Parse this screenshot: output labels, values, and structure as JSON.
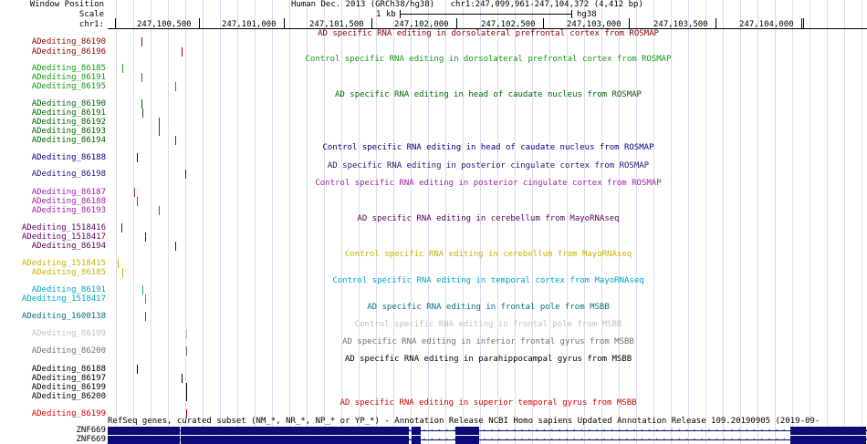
{
  "ruler": {
    "window_position_label": "Window Position",
    "scale_label": "Scale",
    "chrom_label": "chr1:",
    "assembly": "Human Dec. 2013 (GRCh38/hg38)",
    "range": "chr1:247,099,961-247,104,372 (4,412 bp)",
    "scale_value": "1 kb",
    "scale_db": "hg38",
    "positions": [
      "247,100,500",
      "247,101,000",
      "247,101,500",
      "247,102,000",
      "247,102,500",
      "247,103,000",
      "247,103,500",
      "247,104,000"
    ]
  },
  "tracks": [
    {
      "title": "AD specific RNA editing in dorsolateral prefrontal cortex from ROSMAP",
      "color": "#8b0000",
      "items": [
        "ADediting_86190",
        "ADediting_86196"
      ]
    },
    {
      "title": "Control specific RNA editing in dorsolateral prefrontal cortex from ROSMAP",
      "color": "#139a13",
      "items": [
        "ADediting_86185",
        "ADediting_86191",
        "ADediting_86195"
      ]
    },
    {
      "title": "AD specific RNA editing in head of caudate nucleus from ROSMAP",
      "color": "#006400",
      "items": [
        "ADediting_86190",
        "ADediting_86191",
        "ADediting_86192",
        "ADediting_86193",
        "ADediting_86194"
      ]
    },
    {
      "title": "Control specific RNA editing in head of caudate nucleus from ROSMAP",
      "color": "#000080",
      "items": [
        "ADediting_86188"
      ]
    },
    {
      "title": "AD specific RNA editing in posterior cingulate cortex from ROSMAP",
      "color": "#191970",
      "items": [
        "ADediting_86198"
      ]
    },
    {
      "title": "Control specific RNA editing in posterior cingulate cortex from ROSMAP",
      "color": "#a020a0",
      "items": [
        "ADediting_86187",
        "ADediting_86188",
        "ADediting_86193"
      ]
    },
    {
      "title": "AD specific RNA editing in cerebellum from MayoRNAseq",
      "color": "#5c005c",
      "items": [
        "ADediting_1518416",
        "ADediting_1518417",
        "ADediting_86194"
      ]
    },
    {
      "title": "Control specific RNA editing in cerebellum from MayoRNAseq",
      "color": "#c8b400",
      "items": [
        "ADediting_1518415",
        "ADediting_86185"
      ]
    },
    {
      "title": "Control specific RNA editing in temporal cortex from MayoRNAseq",
      "color": "#00a8c0",
      "items": [
        "ADediting_86191",
        "ADediting_1518417"
      ]
    },
    {
      "title": "AD specific RNA editing in frontal pole from MSBB",
      "color": "#007080",
      "items": [
        "ADediting_1600138"
      ]
    },
    {
      "title": "Control specific RNA editing in frontal pole from MSBB",
      "color": "#c0c0c0",
      "items": [
        "ADediting_86199"
      ]
    },
    {
      "title": "AD specific RNA editing in inferior frontal gyrus from MSBB",
      "color": "#707070",
      "items": [
        "ADediting_86200"
      ]
    },
    {
      "title": "AD specific RNA editing in parahippocampal gyrus from MSBB",
      "color": "#000000",
      "items": [
        "ADediting_86188",
        "ADediting_86197",
        "ADediting_86199",
        "ADediting_86200"
      ]
    },
    {
      "title": "AD specific RNA editing in superior temporal gyrus from MSBB",
      "color": "#d00000",
      "items": [
        "ADediting_86199"
      ]
    }
  ],
  "refseq": {
    "title": "RefSeq genes, curated subset (NM_*, NR_*, NP_* or YP_*) - Annotation Release NCBI Homo sapiens Updated Annotation Release 109.20190905 (2019-09-",
    "color": "#0c0c78",
    "genes": [
      "ZNF669",
      "ZNF669"
    ]
  }
}
